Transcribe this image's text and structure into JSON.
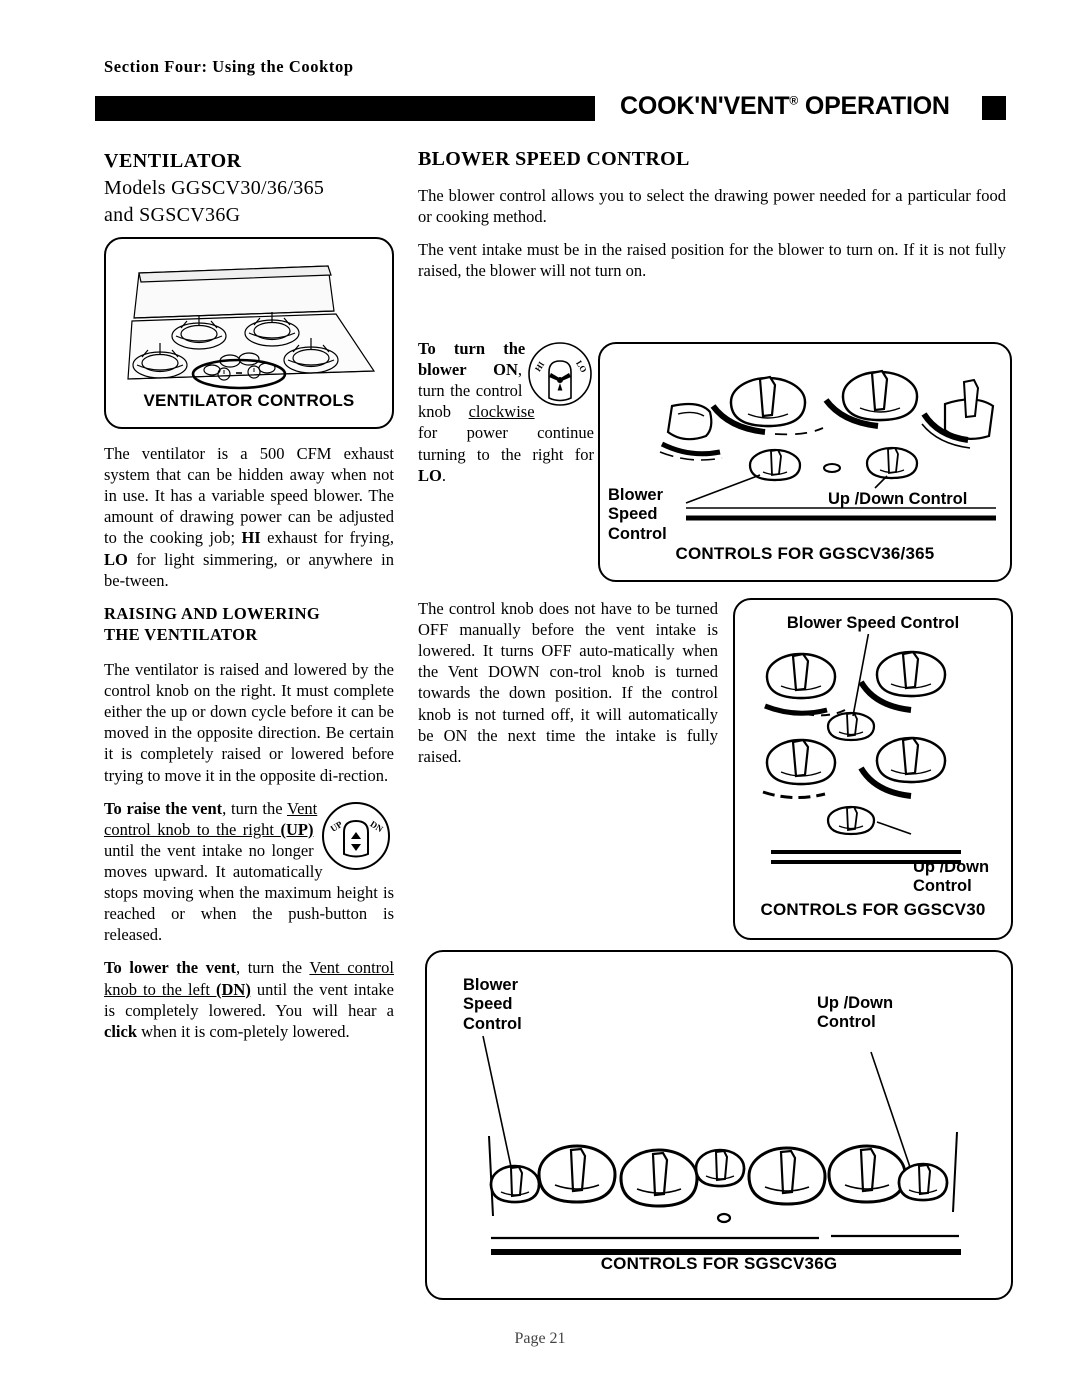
{
  "header": {
    "section_label": "Section Four: Using the Cooktop",
    "title": "COOK'N'VENT",
    "title_sup": "®",
    "title_rest": " OPERATION"
  },
  "left_column": {
    "heading_line1": "VENTILATOR",
    "heading_line2": "Models  GGSCV30/36/365",
    "heading_line3": "and SGSCV36G",
    "ventilator_box_caption": "VENTILATOR CONTROLS",
    "paragraph_1": "The ventilator is a 500 CFM exhaust system that can be hidden away when not in use. It has a variable speed blower. The amount of drawing power can be adjusted to the cooking job; HI exhaust for frying, LO for light simmering, or anywhere in be-tween.",
    "subhead_line1": "RAISING AND LOWERING",
    "subhead_line2": "THE VENTILATOR",
    "paragraph_2": "The ventilator is raised and lowered by the control knob on the right. It must complete either the up or down cycle before it can be moved in the opposite direction. Be certain it is completely raised or lowered before trying to move it in the opposite di-rection.",
    "raise_vent_bold": "To raise the vent",
    "raise_vent_text": ", turn the Vent control knob to the right (UP) until the vent intake no longer moves upward. It automatically stops moving when the maximum height is reached or when the push-button is released.",
    "lower_vent_bold": "To lower the vent",
    "lower_vent_text": ", turn the Vent control knob to the left (DN) until the vent intake is completely lowered. You will hear a click when it is completely lowered."
  },
  "right_column": {
    "heading": "BLOWER SPEED CONTROL",
    "paragraph_1": "The blower control allows you to select the drawing power needed for a particular food or cooking method.",
    "paragraph_2": "The vent intake must be in the raised position for the blower to turn on. If it is not fully raised, the blower will not turn on.",
    "turn_on_bold": "To turn the blower ON",
    "turn_on_text": ", turn the control knob clockwise for power continue turning to the right for LO.",
    "paragraph_3": "The control knob does not have to be turned OFF manually before the vent intake is lowered. It turns OFF auto-matically when the Vent DOWN con-trol knob is turned towards the down position. If the control knob is not turned off, it will automatically be ON the next time  the intake is fully raised."
  },
  "knobs": {
    "hi_label": "HI",
    "lo_label": "LO",
    "up_label": "UP",
    "dn_label": "DN"
  },
  "diagrams": {
    "ggscv36_365": {
      "caption": "CONTROLS FOR GGSCV36/365",
      "blower_label": "Blower\nSpeed\nControl",
      "updown_label": "Up /Down Control"
    },
    "ggscv30": {
      "caption": "CONTROLS FOR GGSCV30",
      "blower_label": "Blower Speed Control",
      "updown_label": "Up /Down\nControl"
    },
    "sgscv36g": {
      "caption": "CONTROLS FOR SGSCV36G",
      "blower_label": "Blower\nSpeed\nControl",
      "updown_label": "Up /Down\nControl"
    }
  },
  "footer": {
    "page_number": "Page 21"
  }
}
